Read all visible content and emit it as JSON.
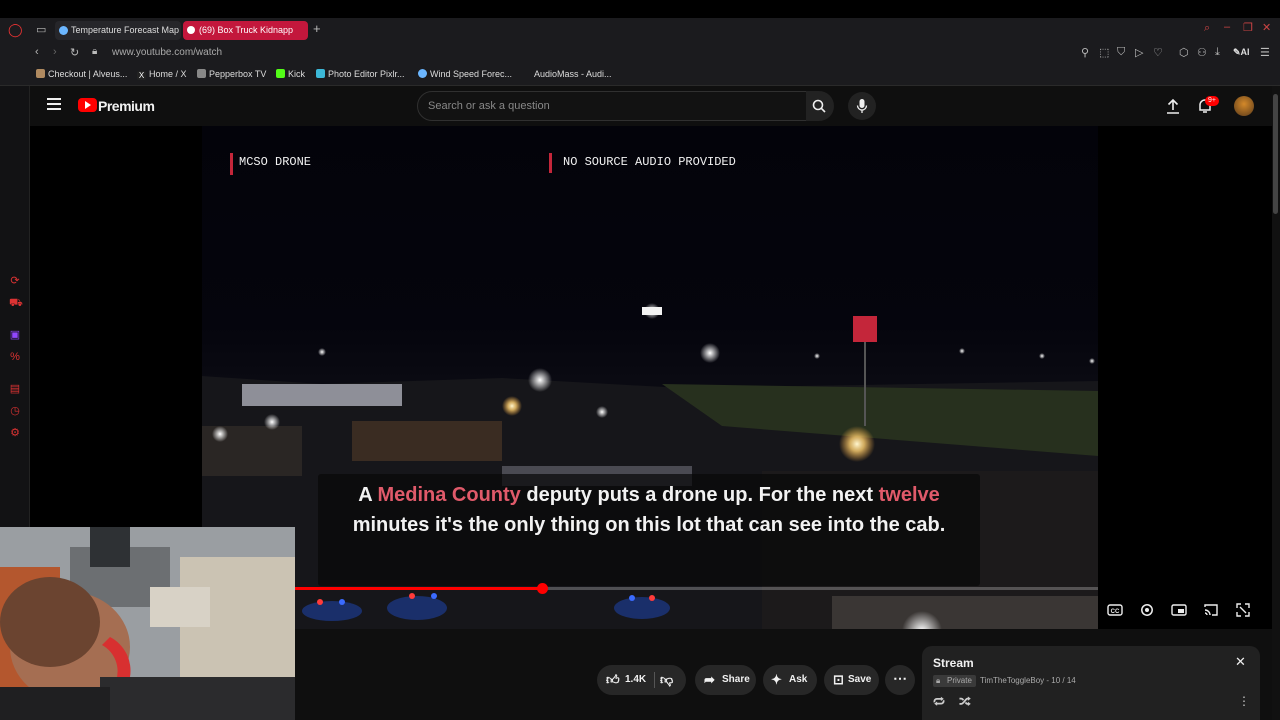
{
  "browser": {
    "tabs": [
      {
        "label": "Temperature Forecast Map"
      },
      {
        "label": "(69) Box Truck Kidnapp"
      }
    ],
    "url": "www.youtube.com/watch",
    "ai_label": "AI",
    "bookmarks": [
      {
        "label": "Checkout | Alveus..."
      },
      {
        "label": "Home / X"
      },
      {
        "label": "Pepperbox TV"
      },
      {
        "label": "Kick"
      },
      {
        "label": "Photo Editor Pixlr..."
      },
      {
        "label": "Wind Speed Forec..."
      },
      {
        "label": "AudioMass - Audi..."
      }
    ]
  },
  "youtube": {
    "logo_label": "Premium",
    "search_placeholder": "Search or ask a question",
    "notification_badge": "9+"
  },
  "video": {
    "overlay_left": "MCSO DRONE",
    "overlay_right": "NO SOURCE AUDIO PROVIDED",
    "caption": {
      "w1": "A",
      "h1": "Medina County",
      "w2": "deputy puts a drone up. For the next",
      "h2": "twelve",
      "w3": "minutes it's the only thing on this lot that can see into the cab."
    },
    "progress_fraction": 0.308,
    "accent": "#ff0000"
  },
  "actions": {
    "likes": "1.4K",
    "share_label": "Share",
    "ask_label": "Ask",
    "save_label": "Save"
  },
  "playlist": {
    "title": "Stream",
    "privacy": "Private",
    "meta": "TimTheToggleBoy - 10 / 14"
  }
}
